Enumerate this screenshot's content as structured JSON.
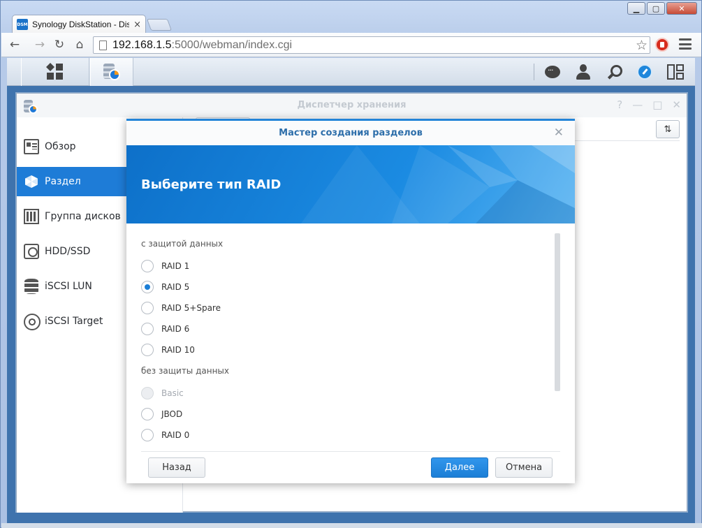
{
  "browser": {
    "tab_title": "Synology DiskStation - Dis",
    "tab_favicon": "DSM",
    "tab_close": "×",
    "url_host": "192.168.1.5",
    "url_rest": ":5000/webman/index.cgi",
    "window_controls": {
      "minimize": "▁",
      "maximize": "▢",
      "close": "✕"
    },
    "nav": {
      "back": "←",
      "forward": "→",
      "reload": "↻",
      "home": "⌂"
    },
    "star": "☆"
  },
  "dsm": {
    "app_window_title": "Диспетчер хранения",
    "app_window_controls": {
      "help": "?",
      "minimize": "—",
      "maximize": "□",
      "close": "✕"
    },
    "sort_button": "⇅"
  },
  "sidebar": {
    "items": [
      {
        "label": "Обзор",
        "icon": "overview-icon"
      },
      {
        "label": "Раздел",
        "icon": "volume-icon",
        "active": true
      },
      {
        "label": "Группа дисков",
        "icon": "disk-group-icon"
      },
      {
        "label": "HDD/SSD",
        "icon": "hdd-icon"
      },
      {
        "label": "iSCSI LUN",
        "icon": "iscsi-lun-icon"
      },
      {
        "label": "iSCSI Target",
        "icon": "iscsi-target-icon"
      }
    ]
  },
  "wizard": {
    "title": "Мастер создания разделов",
    "close": "✕",
    "banner_title": "Выберите тип RAID",
    "protected_label": "с защитой данных",
    "unprotected_label": "без защиты данных",
    "protected_options": [
      {
        "label": "RAID 1",
        "checked": false
      },
      {
        "label": "RAID 5",
        "checked": true
      },
      {
        "label": "RAID 5+Spare",
        "checked": false
      },
      {
        "label": "RAID 6",
        "checked": false
      },
      {
        "label": "RAID 10",
        "checked": false
      }
    ],
    "unprotected_options": [
      {
        "label": "Basic",
        "disabled": true
      },
      {
        "label": "JBOD",
        "disabled": false
      },
      {
        "label": "RAID 0",
        "disabled": false
      }
    ],
    "buttons": {
      "back": "Назад",
      "next": "Далее",
      "cancel": "Отмена"
    }
  },
  "colors": {
    "accent": "#1e7cd7",
    "banner": "#1b8be2",
    "dsm_background": "#3f73ad"
  }
}
